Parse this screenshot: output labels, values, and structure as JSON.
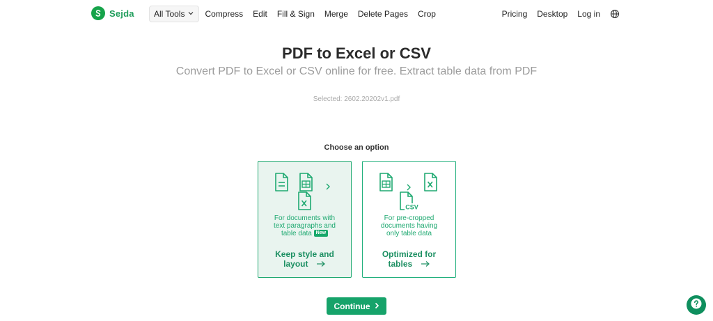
{
  "brand": {
    "name": "Sejda",
    "color": "#16a34a"
  },
  "nav": {
    "all_tools": "All Tools",
    "links": [
      "Compress",
      "Edit",
      "Fill & Sign",
      "Merge",
      "Delete Pages",
      "Crop"
    ],
    "right": [
      "Pricing",
      "Desktop",
      "Log in"
    ]
  },
  "hero": {
    "title": "PDF to Excel or CSV",
    "subtitle": "Convert PDF to Excel or CSV online for free. Extract table data from PDF",
    "selected": "Selected: 2602.20202v1.pdf"
  },
  "options": {
    "heading": "Choose an option",
    "items": [
      {
        "desc_line1": "For documents with",
        "desc_line2": "text paragraphs and",
        "desc_line3": "table data",
        "badge": "New",
        "title_line1": "Keep style and",
        "title_line2": "layout",
        "selected": true
      },
      {
        "desc_line1": "For pre-cropped",
        "desc_line2": "documents having",
        "desc_line3": "only table data",
        "csv_label": "CSV",
        "title_line1": "Optimized for",
        "title_line2": "tables",
        "selected": false
      }
    ]
  },
  "actions": {
    "continue": "Continue"
  },
  "icons": [
    "sejda-logo-icon",
    "chevron-down-icon",
    "globe-icon",
    "document-text-icon",
    "spreadsheet-icon",
    "excel-file-icon",
    "csv-file-icon",
    "chevron-right-icon",
    "arrow-right-icon",
    "help-icon"
  ]
}
